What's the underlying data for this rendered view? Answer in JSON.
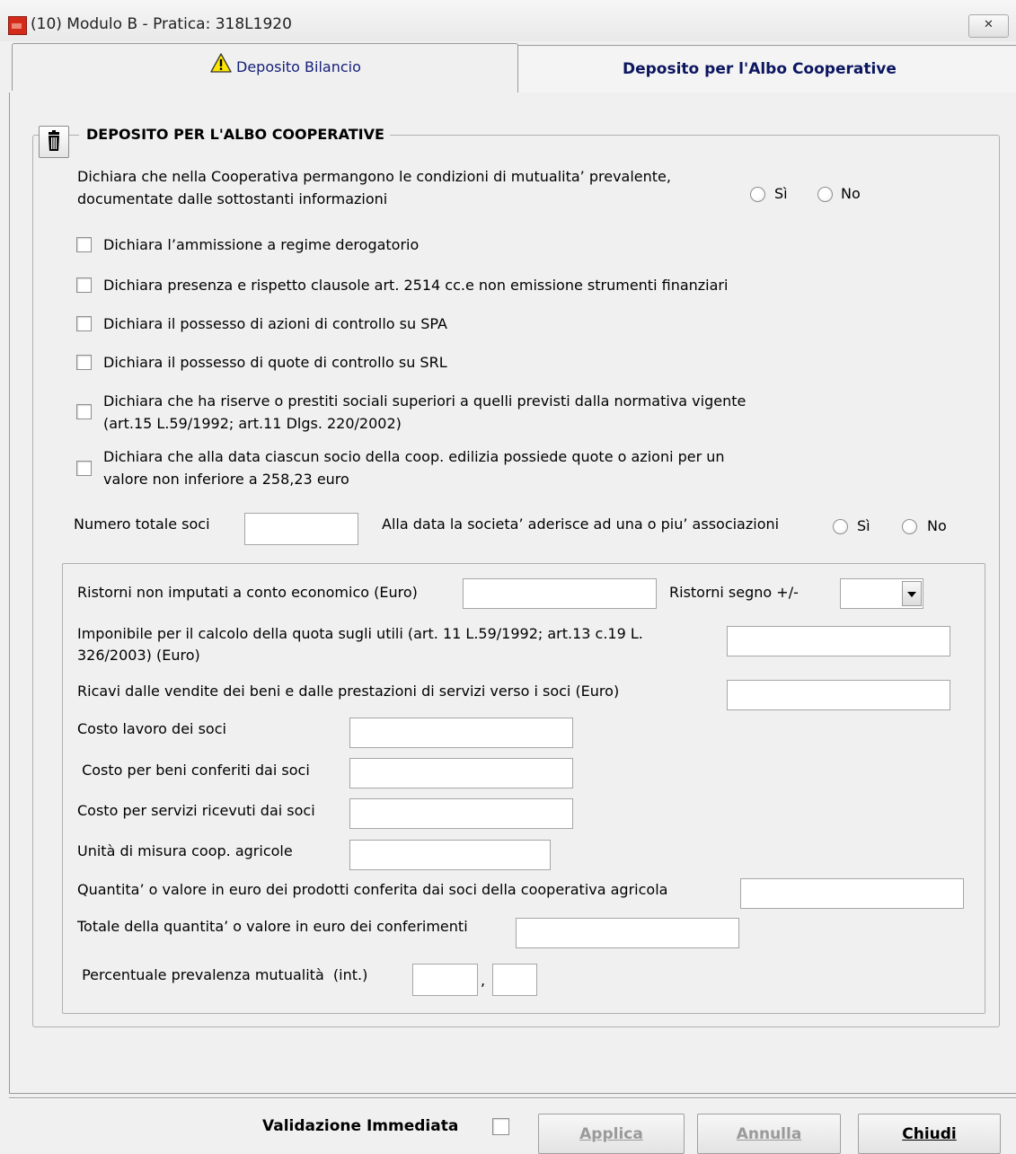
{
  "window": {
    "title": "(10) Modulo B - Pratica: 318L1920",
    "close_label": "✕"
  },
  "tabs": [
    {
      "label": "Deposito Bilancio",
      "icon": "warning-icon"
    },
    {
      "label": "Deposito per l'Albo Cooperative"
    }
  ],
  "section": {
    "title": "DEPOSITO PER L'ALBO COOPERATIVE",
    "trash_icon": "trash-icon"
  },
  "mutualita": {
    "text_line1": "Dichiara che nella Cooperativa permangono le condizioni di mutualita’ prevalente,",
    "text_line2": "documentate dalle sottostanti informazioni",
    "yes": "Sì",
    "no": "No"
  },
  "checkboxes": [
    {
      "line1": "Dichiara l’ammissione a regime derogatorio",
      "checked": false
    },
    {
      "line1": "Dichiara presenza e rispetto clausole  art. 2514 cc.e non emissione strumenti finanziari",
      "checked": false
    },
    {
      "line1": "Dichiara il possesso di azioni di controllo su SPA",
      "checked": false
    },
    {
      "line1": "Dichiara il possesso di quote di controllo su SRL",
      "checked": false
    },
    {
      "line1": "Dichiara che ha riserve o prestiti sociali superiori a quelli previsti dalla normativa vigente",
      "line2": "(art.15 L.59/1992; art.11 Dlgs. 220/2002)",
      "checked": false
    },
    {
      "line1": " Dichiara che alla data ciascun socio della coop. edilizia possiede quote o azioni per un",
      "line2": "valore non inferiore a 258,23 euro",
      "checked": false
    }
  ],
  "soci": {
    "numero_label": "Numero totale soci",
    "numero_value": "",
    "associazioni_label": "Alla data la societa’ aderisce ad una o piu’ associazioni",
    "yes": "Sì",
    "no": "No"
  },
  "fields": {
    "ristorni_label": "Ristorni non imputati a conto economico (Euro)",
    "ristorni_value": "",
    "segno_label": "Ristorni segno +/-",
    "segno_value": "",
    "imponibile_line1": "Imponibile per il calcolo della quota sugli utili (art. 11 L.59/1992; art.13 c.19 L.",
    "imponibile_line2": "326/2003) (Euro)",
    "imponibile_value": "",
    "ricavi_label": "Ricavi dalle vendite dei beni e dalle prestazioni di servizi verso i soci (Euro)",
    "ricavi_value": "",
    "costo_lavoro_label": "Costo lavoro dei soci",
    "costo_lavoro_value": "",
    "costo_beni_label": " Costo per beni conferiti dai soci",
    "costo_beni_value": "",
    "costo_servizi_label": "Costo per servizi ricevuti dai soci",
    "costo_servizi_value": "",
    "unita_label": "Unità di misura coop. agricole",
    "unita_value": "",
    "quantita_label": "Quantita’ o valore in euro dei prodotti conferita dai soci della cooperativa agricola",
    "quantita_value": "",
    "totale_label": "Totale della quantita’ o valore in euro dei conferimenti",
    "totale_value": "",
    "percentuale_label": " Percentuale prevalenza mutualità  (int.)",
    "percentuale_int": "",
    "percentuale_sep": ",",
    "percentuale_dec": ""
  },
  "footer": {
    "validazione_label": "Validazione Immediata",
    "validazione_checked": false,
    "applica": "Applica",
    "annulla": "Annulla",
    "chiudi": "Chiudi"
  }
}
